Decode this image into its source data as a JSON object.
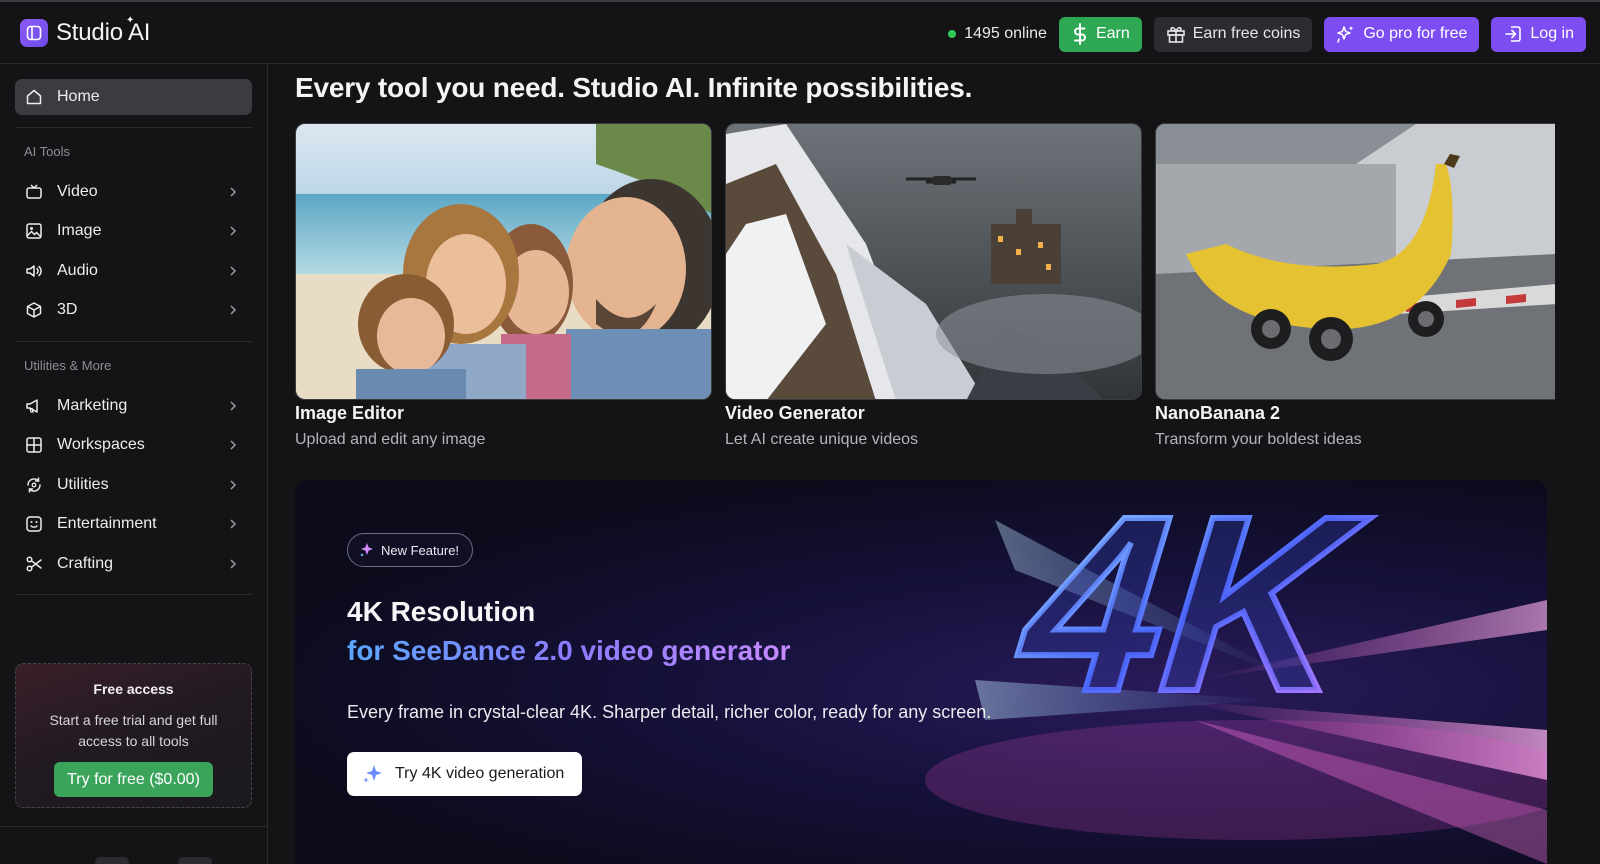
{
  "brand": {
    "name": "Studio AI"
  },
  "header": {
    "online_text": "1495 online",
    "earn_label": "Earn",
    "coins_label": "Earn free coins",
    "pro_label": "Go pro for free",
    "login_label": "Log in"
  },
  "sidebar": {
    "home": "Home",
    "section_ai": "AI Tools",
    "ai_items": [
      {
        "label": "Video",
        "icon": "tv-icon"
      },
      {
        "label": "Image",
        "icon": "image-icon"
      },
      {
        "label": "Audio",
        "icon": "speaker-icon"
      },
      {
        "label": "3D",
        "icon": "cube-icon"
      }
    ],
    "section_util": "Utilities & More",
    "util_items": [
      {
        "label": "Marketing",
        "icon": "megaphone-icon"
      },
      {
        "label": "Workspaces",
        "icon": "grid-icon"
      },
      {
        "label": "Utilities",
        "icon": "cycle-icon"
      },
      {
        "label": "Entertainment",
        "icon": "face-icon"
      },
      {
        "label": "Crafting",
        "icon": "scissors-icon"
      }
    ],
    "promo": {
      "title": "Free access",
      "text": "Start a free trial and get full access to all tools",
      "button": "Try for free ($0.00)"
    }
  },
  "main": {
    "headline": "Every tool you need. Studio AI. Infinite possibilities.",
    "cards": [
      {
        "title": "Image Editor",
        "subtitle": "Upload and edit any image"
      },
      {
        "title": "Video Generator",
        "subtitle": "Let AI create unique videos"
      },
      {
        "title": "NanoBanana 2",
        "subtitle": "Transform your boldest ideas"
      }
    ],
    "banner": {
      "badge": "New Feature!",
      "title": "4K Resolution",
      "subtitle": "for SeeDance 2.0 video generator",
      "description": "Every frame in crystal-clear 4K. Sharper detail, richer color, ready for any screen.",
      "button": "Try 4K video generation",
      "art_text": "4K"
    }
  },
  "colors": {
    "accent": "#7c4ef2",
    "success": "#2fa856",
    "background": "#141416"
  }
}
